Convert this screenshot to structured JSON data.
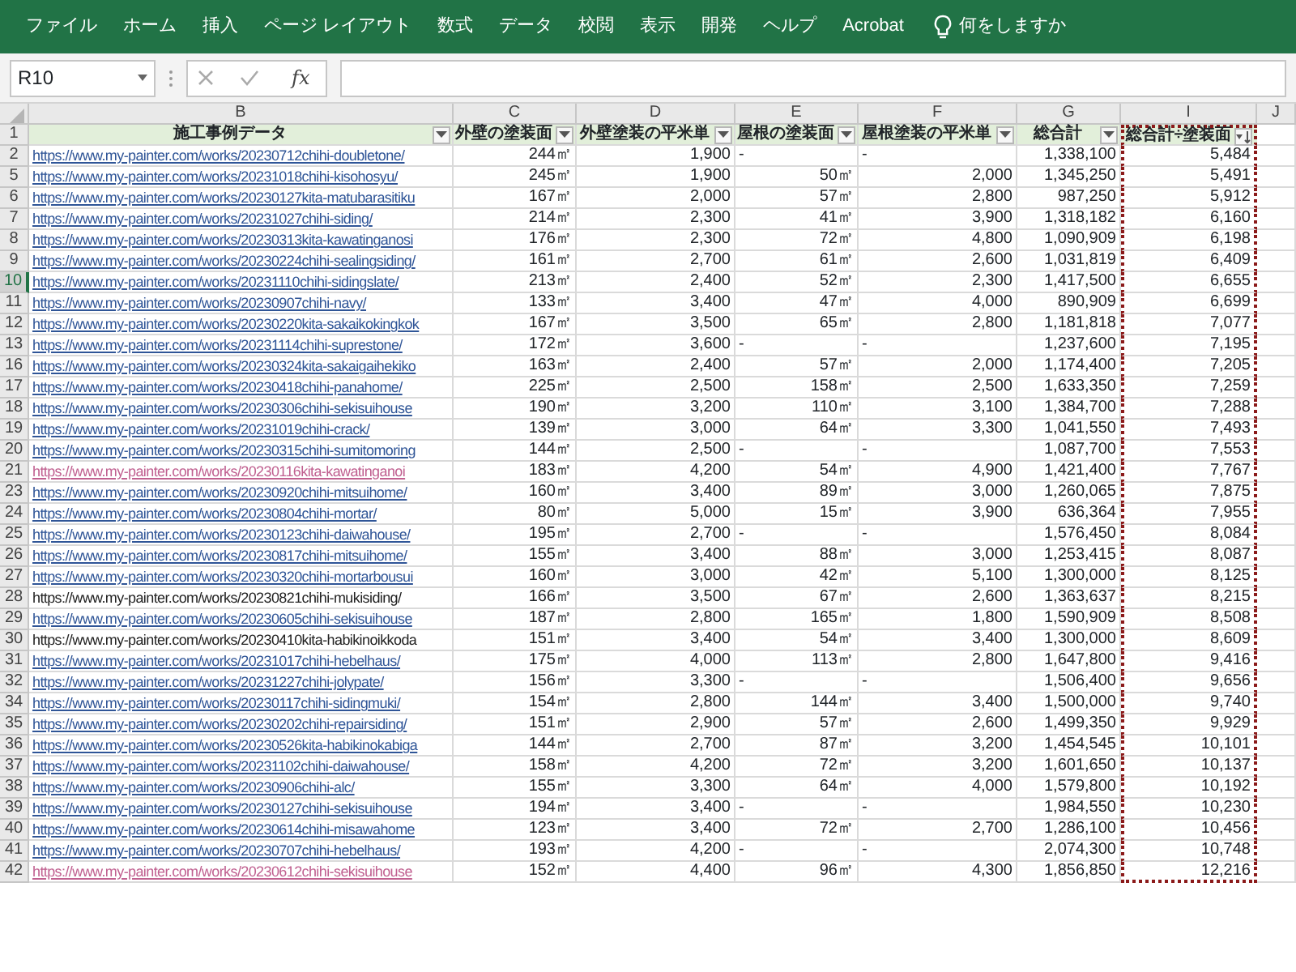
{
  "ribbon": {
    "tabs": [
      "ファイル",
      "ホーム",
      "挿入",
      "ページ レイアウト",
      "数式",
      "データ",
      "校閲",
      "表示",
      "開発",
      "ヘルプ",
      "Acrobat"
    ],
    "tell_me": "何をしますか"
  },
  "formula_bar": {
    "name_box": "R10",
    "fx": "fx"
  },
  "sheet": {
    "column_letters": [
      "B",
      "C",
      "D",
      "E",
      "F",
      "G",
      "I",
      "J"
    ],
    "header_row": {
      "number": "1",
      "columns": [
        {
          "label": "施工事例データ",
          "sorted": false,
          "marquee": false
        },
        {
          "label": "外壁の塗装面",
          "sorted": false,
          "marquee": false
        },
        {
          "label": "外壁塗装の平米単",
          "sorted": false,
          "marquee": false
        },
        {
          "label": "屋根の塗装面",
          "sorted": false,
          "marquee": false
        },
        {
          "label": "屋根塗装の平米単",
          "sorted": false,
          "marquee": false
        },
        {
          "label": "総合計",
          "sorted": false,
          "marquee": false
        },
        {
          "label": "総合計÷塗装面",
          "sorted": true,
          "marquee": true
        }
      ]
    },
    "rows": [
      {
        "number": "2",
        "selected": false,
        "kind": "link",
        "cells": [
          "https://www.my-painter.com/works/20230712chihi-doubletone/",
          "244㎡",
          "1,900",
          "-",
          "-",
          "1,338,100",
          "5,484"
        ]
      },
      {
        "number": "5",
        "selected": false,
        "kind": "link",
        "cells": [
          "https://www.my-painter.com/works/20231018chihi-kisohosyu/",
          "245㎡",
          "1,900",
          "50㎡",
          "2,000",
          "1,345,250",
          "5,491"
        ]
      },
      {
        "number": "6",
        "selected": false,
        "kind": "link",
        "cells": [
          "https://www.my-painter.com/works/20230127kita-matubarasitiku",
          "167㎡",
          "2,000",
          "57㎡",
          "2,800",
          "987,250",
          "5,912"
        ]
      },
      {
        "number": "7",
        "selected": false,
        "kind": "link",
        "cells": [
          "https://www.my-painter.com/works/20231027chihi-siding/",
          "214㎡",
          "2,300",
          "41㎡",
          "3,900",
          "1,318,182",
          "6,160"
        ]
      },
      {
        "number": "8",
        "selected": false,
        "kind": "link",
        "cells": [
          "https://www.my-painter.com/works/20230313kita-kawatinganosi",
          "176㎡",
          "2,300",
          "72㎡",
          "4,800",
          "1,090,909",
          "6,198"
        ]
      },
      {
        "number": "9",
        "selected": false,
        "kind": "link",
        "cells": [
          "https://www.my-painter.com/works/20230224chihi-sealingsiding/",
          "161㎡",
          "2,700",
          "61㎡",
          "2,600",
          "1,031,819",
          "6,409"
        ]
      },
      {
        "number": "10",
        "selected": true,
        "kind": "link",
        "cells": [
          "https://www.my-painter.com/works/20231110chihi-sidingslate/",
          "213㎡",
          "2,400",
          "52㎡",
          "2,300",
          "1,417,500",
          "6,655"
        ]
      },
      {
        "number": "11",
        "selected": false,
        "kind": "link",
        "cells": [
          "https://www.my-painter.com/works/20230907chihi-navy/",
          "133㎡",
          "3,400",
          "47㎡",
          "4,000",
          "890,909",
          "6,699"
        ]
      },
      {
        "number": "12",
        "selected": false,
        "kind": "link",
        "cells": [
          "https://www.my-painter.com/works/20230220kita-sakaikokingkok",
          "167㎡",
          "3,500",
          "65㎡",
          "2,800",
          "1,181,818",
          "7,077"
        ]
      },
      {
        "number": "13",
        "selected": false,
        "kind": "link",
        "cells": [
          "https://www.my-painter.com/works/20231114chihi-suprestone/",
          "172㎡",
          "3,600",
          "-",
          "-",
          "1,237,600",
          "7,195"
        ]
      },
      {
        "number": "16",
        "selected": false,
        "kind": "link",
        "cells": [
          "https://www.my-painter.com/works/20230324kita-sakaigaihekiko",
          "163㎡",
          "2,400",
          "57㎡",
          "2,000",
          "1,174,400",
          "7,205"
        ]
      },
      {
        "number": "17",
        "selected": false,
        "kind": "link",
        "cells": [
          "https://www.my-painter.com/works/20230418chihi-panahome/",
          "225㎡",
          "2,500",
          "158㎡",
          "2,500",
          "1,633,350",
          "7,259"
        ]
      },
      {
        "number": "18",
        "selected": false,
        "kind": "link",
        "cells": [
          "https://www.my-painter.com/works/20230306chihi-sekisuihouse",
          "190㎡",
          "3,200",
          "110㎡",
          "3,100",
          "1,384,700",
          "7,288"
        ]
      },
      {
        "number": "19",
        "selected": false,
        "kind": "link",
        "cells": [
          "https://www.my-painter.com/works/20231019chihi-crack/",
          "139㎡",
          "3,000",
          "64㎡",
          "3,300",
          "1,041,550",
          "7,493"
        ]
      },
      {
        "number": "20",
        "selected": false,
        "kind": "link",
        "cells": [
          "https://www.my-painter.com/works/20230315chihi-sumitomoring",
          "144㎡",
          "2,500",
          "-",
          "-",
          "1,087,700",
          "7,553"
        ]
      },
      {
        "number": "21",
        "selected": false,
        "kind": "visited",
        "cells": [
          "https://www.my-painter.com/works/20230116kita-kawatinganoi",
          "183㎡",
          "4,200",
          "54㎡",
          "4,900",
          "1,421,400",
          "7,767"
        ]
      },
      {
        "number": "23",
        "selected": false,
        "kind": "link",
        "cells": [
          "https://www.my-painter.com/works/20230920chihi-mitsuihome/",
          "160㎡",
          "3,400",
          "89㎡",
          "3,000",
          "1,260,065",
          "7,875"
        ]
      },
      {
        "number": "24",
        "selected": false,
        "kind": "link",
        "cells": [
          "https://www.my-painter.com/works/20230804chihi-mortar/",
          "80㎡",
          "5,000",
          "15㎡",
          "3,900",
          "636,364",
          "7,955"
        ]
      },
      {
        "number": "25",
        "selected": false,
        "kind": "link",
        "cells": [
          "https://www.my-painter.com/works/20230123chihi-daiwahouse/",
          "195㎡",
          "2,700",
          "-",
          "-",
          "1,576,450",
          "8,084"
        ]
      },
      {
        "number": "26",
        "selected": false,
        "kind": "link",
        "cells": [
          "https://www.my-painter.com/works/20230817chihi-mitsuihome/",
          "155㎡",
          "3,400",
          "88㎡",
          "3,000",
          "1,253,415",
          "8,087"
        ]
      },
      {
        "number": "27",
        "selected": false,
        "kind": "link",
        "cells": [
          "https://www.my-painter.com/works/20230320chihi-mortarbousui",
          "160㎡",
          "3,000",
          "42㎡",
          "5,100",
          "1,300,000",
          "8,125"
        ]
      },
      {
        "number": "28",
        "selected": false,
        "kind": "plain",
        "cells": [
          "https://www.my-painter.com/works/20230821chihi-mukisiding/",
          "166㎡",
          "3,500",
          "67㎡",
          "2,600",
          "1,363,637",
          "8,215"
        ]
      },
      {
        "number": "29",
        "selected": false,
        "kind": "link",
        "cells": [
          "https://www.my-painter.com/works/20230605chihi-sekisuihouse",
          "187㎡",
          "2,800",
          "165㎡",
          "1,800",
          "1,590,909",
          "8,508"
        ]
      },
      {
        "number": "30",
        "selected": false,
        "kind": "plain",
        "cells": [
          "https://www.my-painter.com/works/20230410kita-habikinoikkoda",
          "151㎡",
          "3,400",
          "54㎡",
          "3,400",
          "1,300,000",
          "8,609"
        ]
      },
      {
        "number": "31",
        "selected": false,
        "kind": "link",
        "cells": [
          "https://www.my-painter.com/works/20231017chihi-hebelhaus/",
          "175㎡",
          "4,000",
          "113㎡",
          "2,800",
          "1,647,800",
          "9,416"
        ]
      },
      {
        "number": "32",
        "selected": false,
        "kind": "link",
        "cells": [
          "https://www.my-painter.com/works/20231227chihi-jolypate/",
          "156㎡",
          "3,300",
          "-",
          "-",
          "1,506,400",
          "9,656"
        ]
      },
      {
        "number": "34",
        "selected": false,
        "kind": "link",
        "cells": [
          "https://www.my-painter.com/works/20230117chihi-sidingmuki/",
          "154㎡",
          "2,800",
          "144㎡",
          "3,400",
          "1,500,000",
          "9,740"
        ]
      },
      {
        "number": "35",
        "selected": false,
        "kind": "link",
        "cells": [
          "https://www.my-painter.com/works/20230202chihi-repairsiding/",
          "151㎡",
          "2,900",
          "57㎡",
          "2,600",
          "1,499,350",
          "9,929"
        ]
      },
      {
        "number": "36",
        "selected": false,
        "kind": "link",
        "cells": [
          "https://www.my-painter.com/works/20230526kita-habikinokabiga",
          "144㎡",
          "2,700",
          "87㎡",
          "3,200",
          "1,454,545",
          "10,101"
        ]
      },
      {
        "number": "37",
        "selected": false,
        "kind": "link",
        "cells": [
          "https://www.my-painter.com/works/20231102chihi-daiwahouse/",
          "158㎡",
          "4,200",
          "72㎡",
          "3,200",
          "1,601,650",
          "10,137"
        ]
      },
      {
        "number": "38",
        "selected": false,
        "kind": "link",
        "cells": [
          "https://www.my-painter.com/works/20230906chihi-alc/",
          "155㎡",
          "3,300",
          "64㎡",
          "4,000",
          "1,579,800",
          "10,192"
        ]
      },
      {
        "number": "39",
        "selected": false,
        "kind": "link",
        "cells": [
          "https://www.my-painter.com/works/20230127chihi-sekisuihouse",
          "194㎡",
          "3,400",
          "-",
          "-",
          "1,984,550",
          "10,230"
        ]
      },
      {
        "number": "40",
        "selected": false,
        "kind": "link",
        "cells": [
          "https://www.my-painter.com/works/20230614chihi-misawahome",
          "123㎡",
          "3,400",
          "72㎡",
          "2,700",
          "1,286,100",
          "10,456"
        ]
      },
      {
        "number": "41",
        "selected": false,
        "kind": "link",
        "cells": [
          "https://www.my-painter.com/works/20230707chihi-hebelhaus/",
          "193㎡",
          "4,200",
          "-",
          "-",
          "2,074,300",
          "10,748"
        ]
      },
      {
        "number": "42",
        "selected": false,
        "kind": "visited",
        "cells": [
          "https://www.my-painter.com/works/20230612chihi-sekisuihouse",
          "152㎡",
          "4,400",
          "96㎡",
          "4,300",
          "1,856,850",
          "12,216"
        ]
      }
    ]
  }
}
